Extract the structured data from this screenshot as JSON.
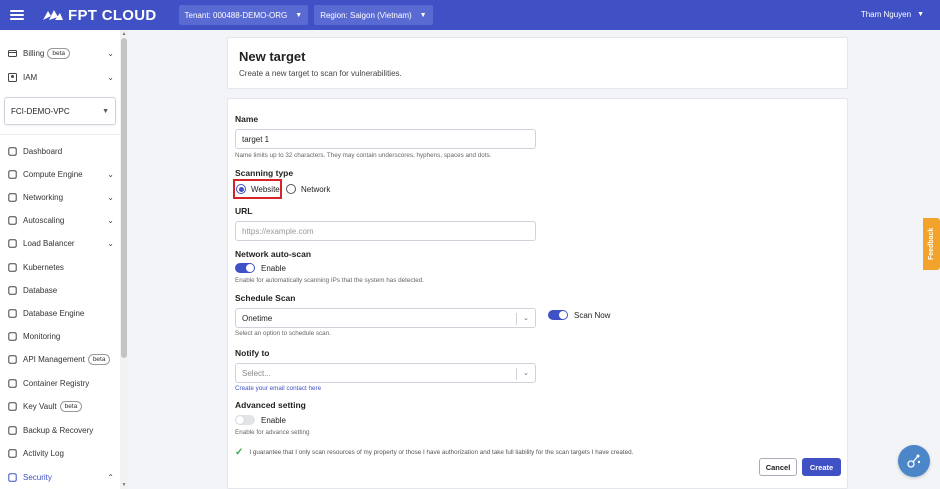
{
  "topbar": {
    "logo_text": "FPT CLOUD",
    "tenant": "Tenant: 000488-DEMO-ORG",
    "region": "Region: Saigon (Vietnam)",
    "user": "Tham Nguyen"
  },
  "sidebar": {
    "billing": "Billing",
    "billing_badge": "beta",
    "iam": "IAM",
    "vpc": "FCI-DEMO-VPC",
    "items": [
      {
        "label": "Dashboard",
        "icon": "dashboard-icon"
      },
      {
        "label": "Compute Engine",
        "icon": "compute-icon"
      },
      {
        "label": "Networking",
        "icon": "network-icon"
      },
      {
        "label": "Autoscaling",
        "icon": "autoscaling-icon"
      },
      {
        "label": "Load Balancer",
        "icon": "load-balancer-icon"
      },
      {
        "label": "Kubernetes",
        "icon": "kubernetes-icon"
      },
      {
        "label": "Database",
        "icon": "database-icon"
      },
      {
        "label": "Database Engine",
        "icon": "database-engine-icon"
      },
      {
        "label": "Monitoring",
        "icon": "monitoring-icon"
      },
      {
        "label": "API Management",
        "icon": "api-icon"
      },
      {
        "label": "Container Registry",
        "icon": "container-icon"
      },
      {
        "label": "Key Vault",
        "icon": "key-icon"
      },
      {
        "label": "Backup & Recovery",
        "icon": "backup-icon"
      },
      {
        "label": "Activity Log",
        "icon": "activity-icon"
      },
      {
        "label": "Security",
        "icon": "security-icon"
      }
    ],
    "beta": "beta"
  },
  "header": {
    "title": "New target",
    "subtitle": "Create a new target to scan for vulnerabilities."
  },
  "form": {
    "name_label": "Name",
    "name_value": "target 1",
    "name_hint": "Name limits up to 32 characters. They may contain underscores, hyphens, spaces and dots.",
    "scan_type_label": "Scanning type",
    "scan_type_website": "Website",
    "scan_type_network": "Network",
    "url_label": "URL",
    "url_placeholder": "https://example.com",
    "auto_scan_label": "Network auto-scan",
    "auto_scan_toggle": "Enable",
    "auto_scan_hint": "Enable for automatically scanning IPs that the system has detected.",
    "schedule_label": "Schedule Scan",
    "schedule_value": "Onetime",
    "scan_now": "Scan Now",
    "schedule_hint": "Select an option to schedule scan.",
    "notify_label": "Notify to",
    "notify_placeholder": "Select...",
    "notify_link": "Create your email contact here",
    "advanced_label": "Advanced setting",
    "advanced_toggle": "Enable",
    "advanced_hint": "Enable for advance setting",
    "guarantee": "I guarantee that I only scan resources of my property or those I have authorization and take full liability for the scan targets I have created.",
    "cancel": "Cancel",
    "create": "Create"
  },
  "feedback": "Feedback",
  "colors": {
    "primary": "#3f51c4",
    "highlight": "#d9232b",
    "feedback": "#f1a32c"
  }
}
